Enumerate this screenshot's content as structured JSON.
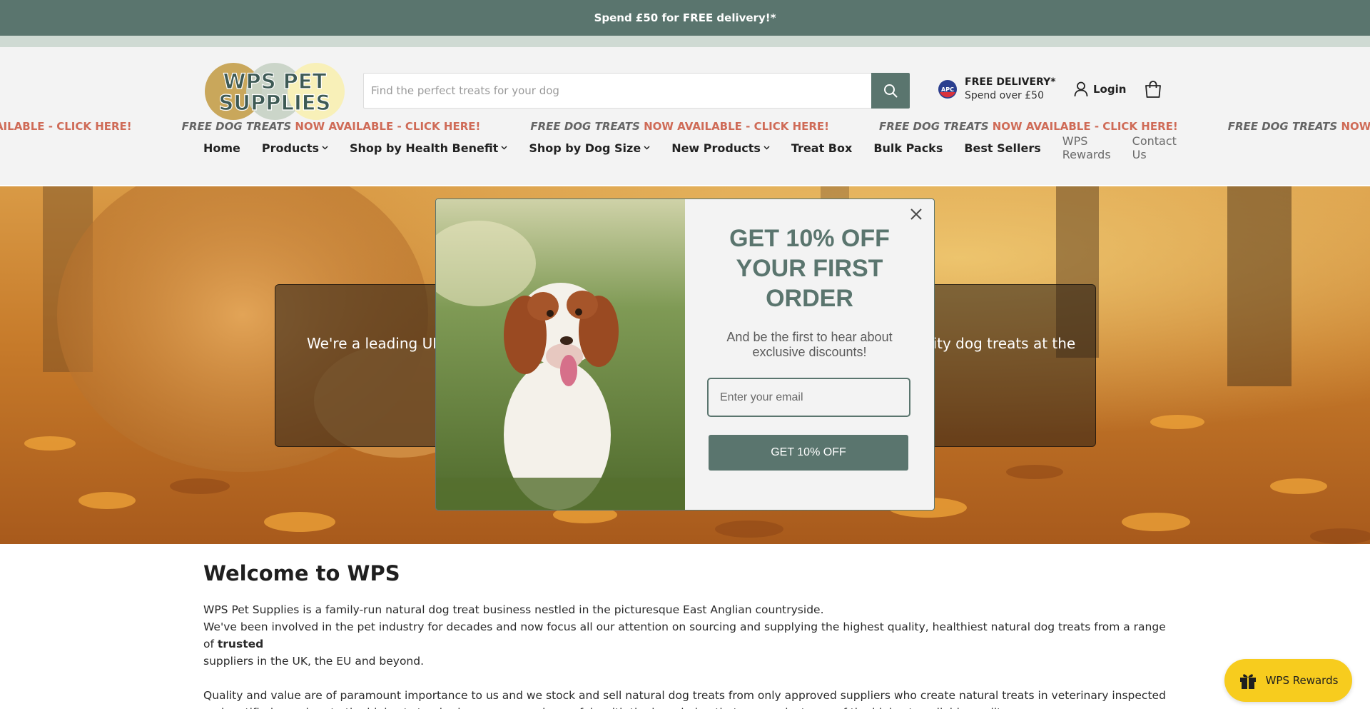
{
  "announcement": {
    "text": "Spend £50 for FREE delivery!*"
  },
  "header": {
    "logo_text": "WPS PET SUPPLIES",
    "search_placeholder": "Find the perfect treats for your dog",
    "delivery_title": "FREE DELIVERY*",
    "delivery_sub": "Spend over £50",
    "login_label": "Login",
    "icons": {
      "search": "search-icon",
      "apc": "apc-logo-icon",
      "user": "user-icon",
      "cart": "shopping-bag-icon"
    }
  },
  "nav": {
    "items": [
      {
        "label": "Home",
        "dropdown": false
      },
      {
        "label": "Products",
        "dropdown": true
      },
      {
        "label": "Shop by Health Benefit",
        "dropdown": true
      },
      {
        "label": "Shop by Dog Size",
        "dropdown": true
      },
      {
        "label": "New Products",
        "dropdown": true
      },
      {
        "label": "Treat Box",
        "dropdown": false
      },
      {
        "label": "Bulk Packs",
        "dropdown": false
      },
      {
        "label": "Best Sellers",
        "dropdown": false
      }
    ],
    "right_items": [
      "WPS Rewards",
      "Contact Us"
    ]
  },
  "ticker": {
    "emphasis": "FREE DOG TREATS",
    "rest": " NOW AVAILABLE - CLICK HERE!",
    "first_partial": "EATS"
  },
  "hero": {
    "text_left": "We're a leading UK",
    "text_right": "lity dog treats at the"
  },
  "popup": {
    "title": "GET 10% OFF YOUR FIRST ORDER",
    "subtitle": "And be the first to hear about exclusive discounts!",
    "email_placeholder": "Enter your email",
    "button_label": "GET 10% OFF",
    "close_icon": "close-icon"
  },
  "content": {
    "heading": "Welcome to WPS",
    "para1_line1": "WPS Pet Supplies is a family-run natural dog treat business nestled in the picturesque East Anglian countryside.",
    "para1_line2_a": "We've been involved in the pet industry for decades and now focus all our attention on sourcing and supplying the highest quality, healthiest natural dog treats from a range of ",
    "para1_line2_bold": "trusted",
    "para1_line3": "suppliers in the UK, the EU and beyond.",
    "para2": "Quality and value are of paramount importance to us and we stock and sell natural dog treats from only approved suppliers who create natural treats in veterinary inspected and certified premises to the highest standards, so you can shop safely with the knowledge that our products are of the highest available quality."
  },
  "rewards_button": {
    "label": "WPS Rewards",
    "icon": "gift-icon"
  },
  "colors": {
    "brand_green": "#5a756e",
    "ticker_red": "#cf6b57",
    "rewards_yellow": "#f7cc1e"
  }
}
